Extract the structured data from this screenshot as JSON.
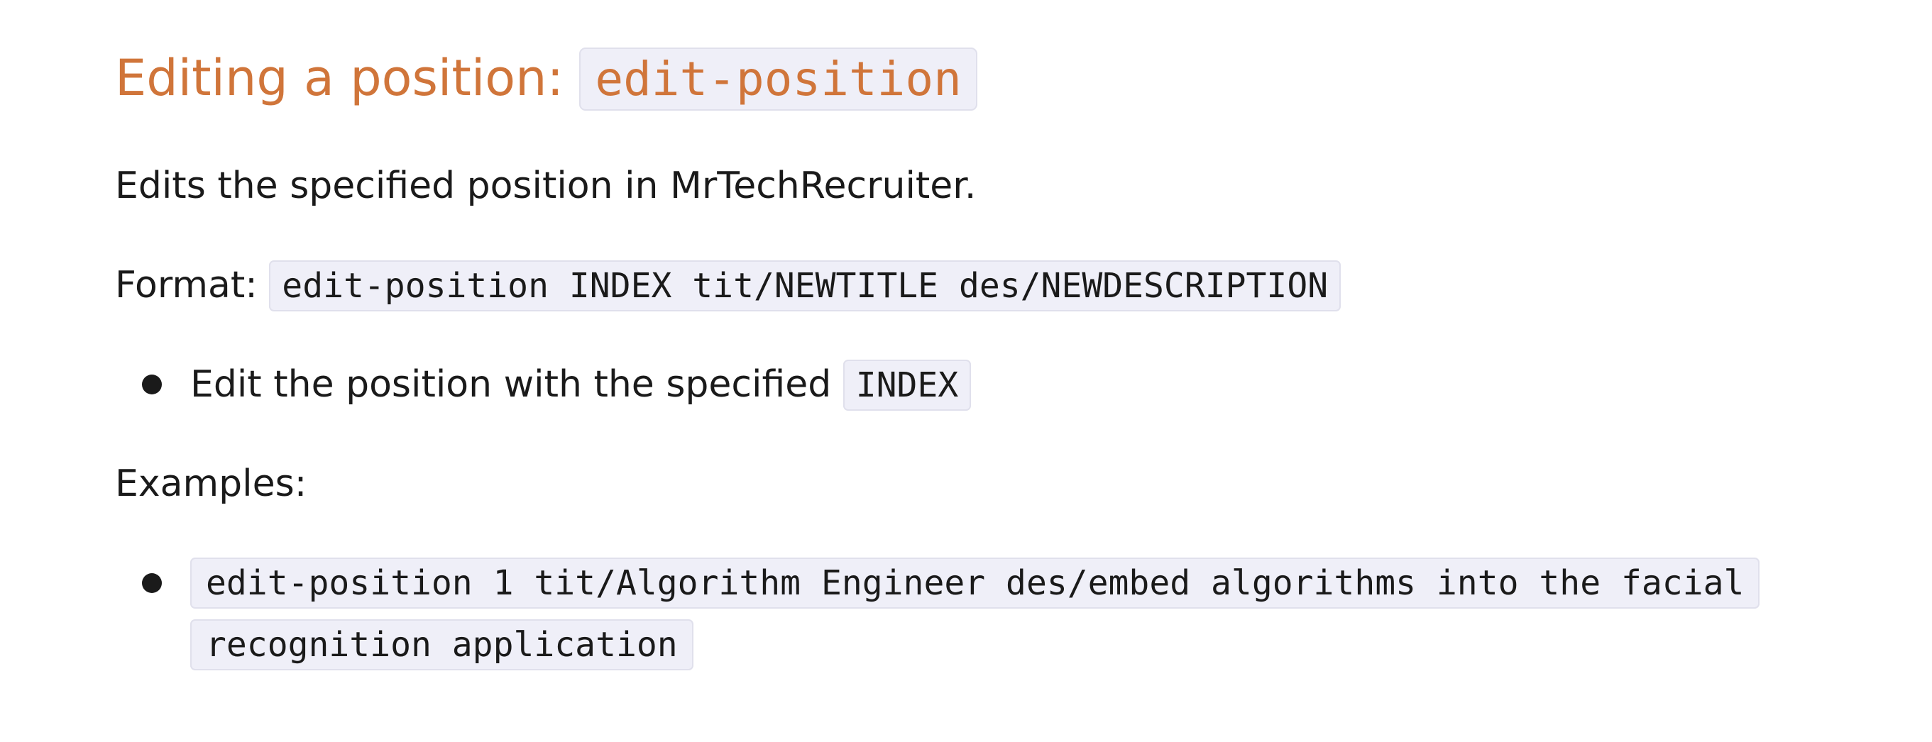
{
  "heading": {
    "text": "Editing a position:",
    "command": "edit-position"
  },
  "description": "Edits the specified position in MrTechRecruiter.",
  "format": {
    "label": "Format:",
    "syntax": "edit-position INDEX tit/NEWTITLE des/NEWDESCRIPTION"
  },
  "rules": [
    {
      "text": "Edit the position with the specified",
      "code": "INDEX"
    }
  ],
  "examples_label": "Examples:",
  "examples": [
    "edit-position 1 tit/Algorithm Engineer des/embed algorithms into the facial recognition application"
  ],
  "colors": {
    "heading": "#d0753a",
    "code_background": "#efeff8",
    "code_border": "#e0e0ec",
    "text": "#1a1a1a"
  }
}
